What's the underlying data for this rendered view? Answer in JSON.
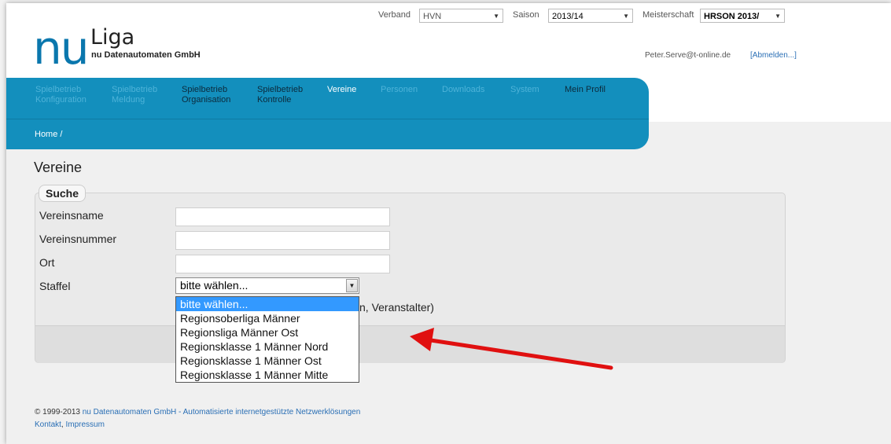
{
  "header": {
    "logo_main": "nu",
    "logo_liga": "Liga",
    "logo_sub": "nu Datenautomaten GmbH",
    "verband_label": "Verband",
    "verband_value": "HVN",
    "saison_label": "Saison",
    "saison_value": "2013/14",
    "meisterschaft_label": "Meisterschaft",
    "meisterschaft_value": "HRSON 2013/",
    "user_email": "Peter.Serve@t-online.de",
    "logout_label": "[Abmelden...]"
  },
  "nav": {
    "items": [
      {
        "line1": "Spielbetrieb",
        "line2": "Konfiguration"
      },
      {
        "line1": "Spielbetrieb",
        "line2": "Meldung"
      },
      {
        "line1": "Spielbetrieb",
        "line2": "Organisation"
      },
      {
        "line1": "Spielbetrieb",
        "line2": "Kontrolle"
      },
      {
        "line1": "Vereine",
        "line2": ""
      },
      {
        "line1": "Personen",
        "line2": ""
      },
      {
        "line1": "Downloads",
        "line2": ""
      },
      {
        "line1": "System",
        "line2": ""
      },
      {
        "line1": "Mein Profil",
        "line2": ""
      }
    ],
    "breadcrumb": "Home /"
  },
  "main": {
    "title": "Vereine",
    "search_legend": "Suche",
    "fields": {
      "vereinsname_label": "Vereinsname",
      "vereinsnummer_label": "Vereinsnummer",
      "ort_label": "Ort",
      "staffel_label": "Staffel",
      "staffel_value": "bitte wählen..."
    },
    "dropdown_options": [
      "bitte wählen...",
      "Regionsoberliga Männer",
      "Regionsliga Männer Ost",
      "Regionsklasse 1 Männer Nord",
      "Regionsklasse 1 Männer Ost",
      "Regionsklasse 1 Männer Mitte"
    ],
    "hidden_text": "n, Veranstalter)"
  },
  "footer": {
    "copyright": "© 1999-2013",
    "company_link": "nu Datenautomaten GmbH - Automatisierte internetgestützte Netzwerklösungen",
    "kontakt": "Kontakt",
    "comma": ",",
    "impressum": "Impressum"
  },
  "colors": {
    "brand_blue": "#138fbd",
    "annotation_red": "#e01010"
  }
}
